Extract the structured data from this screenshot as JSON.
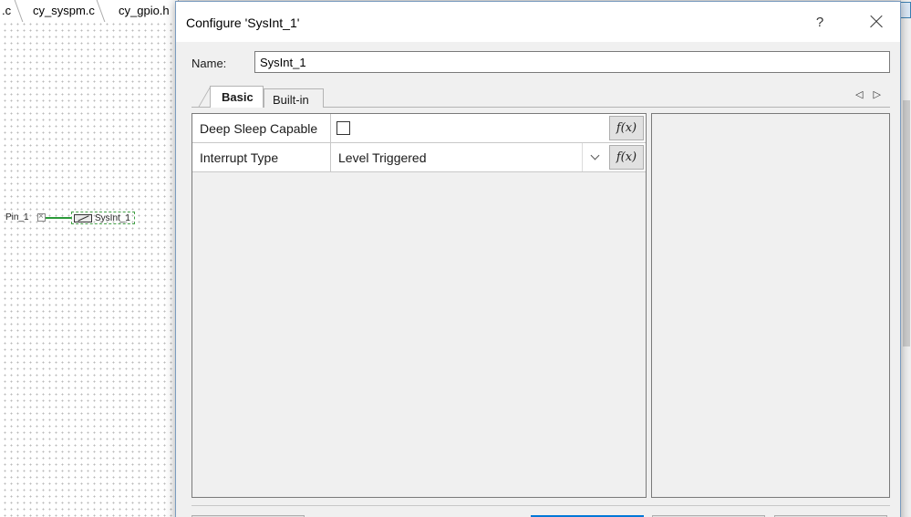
{
  "editor": {
    "tabs": [
      ".c",
      "cy_syspm.c",
      "cy_gpio.h"
    ],
    "schematic": {
      "pin_label": "Pin_1",
      "component_label": "SysInt_1",
      "wire_color": "#2b9a3a"
    }
  },
  "dialog": {
    "title": "Configure 'SysInt_1'",
    "help_label": "?",
    "close_icon": "close-icon",
    "name_label": "Name:",
    "name_value": "SysInt_1",
    "tabs": [
      {
        "label": "Basic",
        "active": true
      },
      {
        "label": "Built-in",
        "active": false
      }
    ],
    "tab_nav": "◁ ▷",
    "parameters": [
      {
        "name": "Deep Sleep Capable",
        "type": "checkbox",
        "checked": false,
        "fx": "f(x)"
      },
      {
        "name": "Interrupt Type",
        "type": "select",
        "value": "Level Triggered",
        "fx": "f(x)"
      }
    ],
    "accent_color": "#0078d7"
  }
}
